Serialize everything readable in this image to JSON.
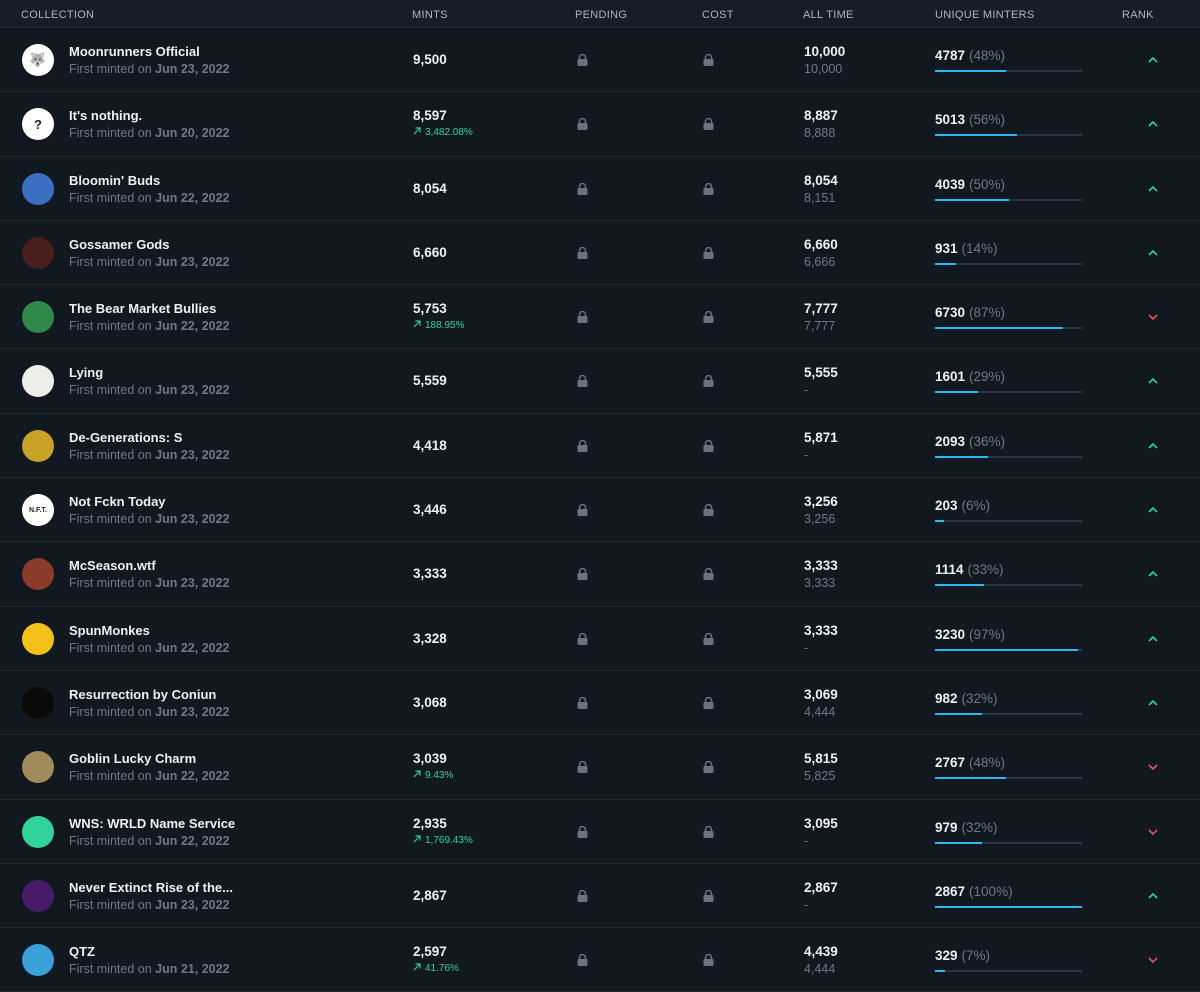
{
  "headers": {
    "collection": "COLLECTION",
    "mints": "MINTS",
    "pending": "PENDING",
    "cost": "COST",
    "all_time": "ALL TIME",
    "unique_minters": "UNIQUE MINTERS",
    "rank": "RANK"
  },
  "minted_prefix": "First minted on",
  "colors": {
    "up": "#2ed3a3",
    "down": "#e0555f",
    "bar": "#2fb7f0",
    "lock": "#6a7380"
  },
  "rows": [
    {
      "name": "Moonrunners Official",
      "date": "Jun 23, 2022",
      "mints": "9,500",
      "change": "",
      "all_time": "10,000",
      "all_time_2": "10,000",
      "unique": "4787",
      "unique_pct": "(48%)",
      "fill": 0.48,
      "rank": "up",
      "avatar_icon": "wolf-avatar-icon",
      "avatar_color": "#ffffff",
      "avatar_glyph": "🐺"
    },
    {
      "name": "It's nothing.",
      "date": "Jun 20, 2022",
      "mints": "8,597",
      "change": "3,482.08%",
      "all_time": "8,887",
      "all_time_2": "8,888",
      "unique": "5013",
      "unique_pct": "(56%)",
      "fill": 0.56,
      "rank": "up",
      "avatar_icon": "question-avatar-icon",
      "avatar_color": "#ffffff",
      "avatar_glyph": "?"
    },
    {
      "name": "Bloomin' Buds",
      "date": "Jun 22, 2022",
      "mints": "8,054",
      "change": "",
      "all_time": "8,054",
      "all_time_2": "8,151",
      "unique": "4039",
      "unique_pct": "(50%)",
      "fill": 0.5,
      "rank": "up",
      "avatar_icon": "bunny-avatar-icon",
      "avatar_color": "#3a6fc2",
      "avatar_glyph": ""
    },
    {
      "name": "Gossamer Gods",
      "date": "Jun 23, 2022",
      "mints": "6,660",
      "change": "",
      "all_time": "6,660",
      "all_time_2": "6,666",
      "unique": "931",
      "unique_pct": "(14%)",
      "fill": 0.14,
      "rank": "up",
      "avatar_icon": "god-avatar-icon",
      "avatar_color": "#4a1e1a",
      "avatar_glyph": ""
    },
    {
      "name": "The Bear Market Bullies",
      "date": "Jun 22, 2022",
      "mints": "5,753",
      "change": "188.95%",
      "all_time": "7,777",
      "all_time_2": "7,777",
      "unique": "6730",
      "unique_pct": "(87%)",
      "fill": 0.87,
      "rank": "down",
      "avatar_icon": "bull-avatar-icon",
      "avatar_color": "#2f8a4a",
      "avatar_glyph": ""
    },
    {
      "name": "Lying",
      "date": "Jun 23, 2022",
      "mints": "5,559",
      "change": "",
      "all_time": "5,555",
      "all_time_2": "-",
      "unique": "1601",
      "unique_pct": "(29%)",
      "fill": 0.29,
      "rank": "up",
      "avatar_icon": "sketch-avatar-icon",
      "avatar_color": "#eeeeea",
      "avatar_glyph": ""
    },
    {
      "name": "De-Generations: S",
      "date": "Jun 23, 2022",
      "mints": "4,418",
      "change": "",
      "all_time": "5,871",
      "all_time_2": "-",
      "unique": "2093",
      "unique_pct": "(36%)",
      "fill": 0.36,
      "rank": "up",
      "avatar_icon": "gold-creature-avatar-icon",
      "avatar_color": "#c9a227",
      "avatar_glyph": ""
    },
    {
      "name": "Not Fckn Today",
      "date": "Jun 23, 2022",
      "mints": "3,446",
      "change": "",
      "all_time": "3,256",
      "all_time_2": "3,256",
      "unique": "203",
      "unique_pct": "(6%)",
      "fill": 0.06,
      "rank": "up",
      "avatar_icon": "nft-text-avatar-icon",
      "avatar_color": "#ffffff",
      "avatar_glyph": "N.F.T."
    },
    {
      "name": "McSeason.wtf",
      "date": "Jun 23, 2022",
      "mints": "3,333",
      "change": "",
      "all_time": "3,333",
      "all_time_2": "3,333",
      "unique": "1114",
      "unique_pct": "(33%)",
      "fill": 0.33,
      "rank": "up",
      "avatar_icon": "character-avatar-icon",
      "avatar_color": "#8a3b2a",
      "avatar_glyph": ""
    },
    {
      "name": "SpunMonkes",
      "date": "Jun 22, 2022",
      "mints": "3,328",
      "change": "",
      "all_time": "3,333",
      "all_time_2": "-",
      "unique": "3230",
      "unique_pct": "(97%)",
      "fill": 0.97,
      "rank": "up",
      "avatar_icon": "monkey-avatar-icon",
      "avatar_color": "#f2c21b",
      "avatar_glyph": ""
    },
    {
      "name": "Resurrection by Coniun",
      "date": "Jun 23, 2022",
      "mints": "3,068",
      "change": "",
      "all_time": "3,069",
      "all_time_2": "4,444",
      "unique": "982",
      "unique_pct": "(32%)",
      "fill": 0.32,
      "rank": "up",
      "avatar_icon": "ring-avatar-icon",
      "avatar_color": "#0a0a0a",
      "avatar_glyph": ""
    },
    {
      "name": "Goblin Lucky Charm",
      "date": "Jun 22, 2022",
      "mints": "3,039",
      "change": "9.43%",
      "all_time": "5,815",
      "all_time_2": "5,825",
      "unique": "2767",
      "unique_pct": "(48%)",
      "fill": 0.48,
      "rank": "down",
      "avatar_icon": "coin-avatar-icon",
      "avatar_color": "#a08a5a",
      "avatar_glyph": ""
    },
    {
      "name": "WNS: WRLD Name Service",
      "date": "Jun 22, 2022",
      "mints": "2,935",
      "change": "1,769.43%",
      "all_time": "3,095",
      "all_time_2": "-",
      "unique": "979",
      "unique_pct": "(32%)",
      "fill": 0.32,
      "rank": "down",
      "avatar_icon": "layers-avatar-icon",
      "avatar_color": "#2fd39b",
      "avatar_glyph": ""
    },
    {
      "name": "Never Extinct Rise of the...",
      "date": "Jun 23, 2022",
      "mints": "2,867",
      "change": "",
      "all_time": "2,867",
      "all_time_2": "-",
      "unique": "2867",
      "unique_pct": "(100%)",
      "fill": 1.0,
      "rank": "up",
      "avatar_icon": "mammoth-avatar-icon",
      "avatar_color": "#4a1a6a",
      "avatar_glyph": ""
    },
    {
      "name": "QTZ",
      "date": "Jun 21, 2022",
      "mints": "2,597",
      "change": "41.76%",
      "all_time": "4,439",
      "all_time_2": "4,444",
      "unique": "329",
      "unique_pct": "(7%)",
      "fill": 0.07,
      "rank": "down",
      "avatar_icon": "alien-avatar-icon",
      "avatar_color": "#3aa0d8",
      "avatar_glyph": ""
    }
  ]
}
